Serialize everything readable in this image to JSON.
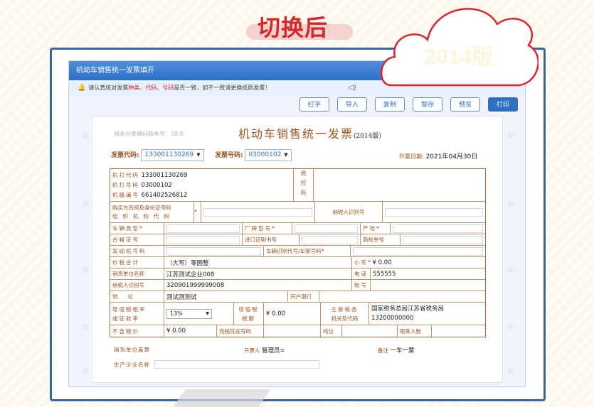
{
  "headline": "切换后",
  "badge": "2014版",
  "window": {
    "title": "机动车销售统一发票填开",
    "notice_pre": "请认真核对发票",
    "notice_hl": "种类、代码、号码",
    "notice_post": "是否一致，如不一致请更换纸质发票！"
  },
  "toolbar": [
    "红字",
    "导入",
    "复制",
    "暂存",
    "预览",
    "打印"
  ],
  "invoice": {
    "version_note": "税收分类编码版本号：38.0",
    "title": "机动车销售统一发票",
    "title_suffix": "(2014版)",
    "code_label": "发票代码:",
    "code_value": "133001130269",
    "number_label": "发票号码:",
    "number_value": "03000102",
    "date_label": "开票日期:",
    "date_value": "2021年04月30日",
    "machine_code_label": "机打代码",
    "machine_code": "133001130269",
    "machine_no_label": "机打号码",
    "machine_no": "03000102",
    "machine_id_label": "机器编号",
    "machine_id": "661402526812",
    "tax_control_label": "税控码",
    "buyer_label_1": "购买方名称及身份证号码",
    "buyer_label_2": "组织机构代码",
    "buyer_taxid_label": "纳税人识别号",
    "vehicle_type_label": "车辆类型",
    "brand_label": "厂牌型号",
    "origin_label": "产地",
    "cert_label": "合格证号",
    "import_cert_label": "进口证明书号",
    "inspection_label": "商检单号",
    "engine_label": "发动机号码",
    "vin_label": "车辆识别代号/车架号码",
    "total_label": "价税合计",
    "total_caps": "（大写）零圆整",
    "total_small_label": "小写",
    "total_small": "¥ 0.00",
    "seller_label": "销货单位名称",
    "seller_name": "江苏测试企业008",
    "phone_label": "电话",
    "phone": "555555",
    "seller_taxid_label": "纳税人识别号",
    "seller_taxid": "320901999999008",
    "account_label": "账号",
    "address_label": "地址",
    "address": "测试测测试",
    "bank_label": "开户银行",
    "vat_rate_label_1": "增值税税率",
    "vat_rate_label_2": "或征收率",
    "vat_rate": "13%",
    "vat_amount_label_1": "增值税",
    "vat_amount_label_2": "税额",
    "vat_amount": "¥ 0.00",
    "tax_office_label_1": "主管税务",
    "tax_office_label_2": "机关及代码",
    "tax_office_name": "国家税务总局江苏省税务局",
    "tax_office_code": "13200000000",
    "pre_tax_label": "不含税价",
    "pre_tax": "¥ 0.00",
    "duty_cert_label": "完税凭证号码",
    "tonnage_label": "吨位",
    "seats_label": "限乘人数",
    "seal_label": "销货单位盖章",
    "issuer_label": "开票人",
    "issuer": "管理员=",
    "remark_label": "备注",
    "remark": "一车一票",
    "manufacturer_label": "生产企业名称"
  }
}
